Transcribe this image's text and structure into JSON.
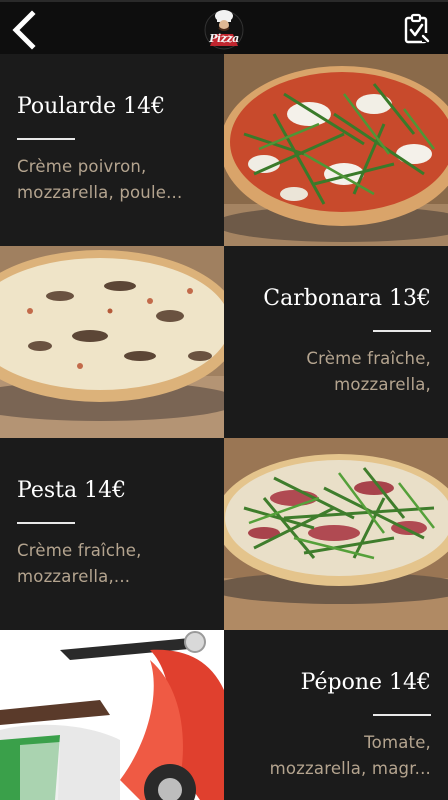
{
  "app": {
    "logo_text": "Pizza",
    "back_icon": "chevron-left-icon",
    "order_icon": "clipboard-check-icon"
  },
  "menu": {
    "items": [
      {
        "name": "Poularde 14€",
        "desc_line1": "Crème poivron,",
        "desc_line2": "mozzarella, poule..."
      },
      {
        "name": "Carbonara 13€",
        "desc_line1": "Crème fraîche,",
        "desc_line2": "mozzarella,"
      },
      {
        "name": "Pesta 14€",
        "desc_line1": "Crème fraîche,",
        "desc_line2": "mozzarella,..."
      },
      {
        "name": "Pépone 14€",
        "desc_line1": "Tomate,",
        "desc_line2": "mozzarella, magr..."
      }
    ]
  },
  "colors": {
    "background": "#1b1b1b",
    "topbar": "#0e0e0e",
    "description_text": "#b4a48f",
    "title_text": "#ffffff"
  }
}
